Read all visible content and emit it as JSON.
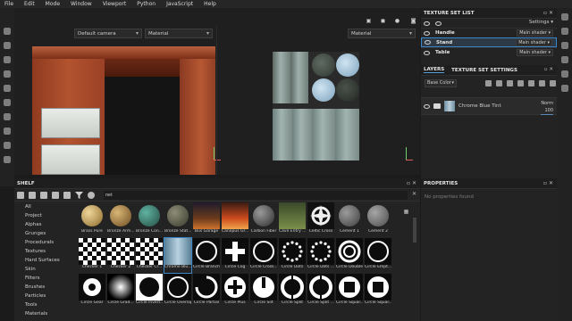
{
  "menu": [
    "File",
    "Edit",
    "Mode",
    "Window",
    "Viewport",
    "Python",
    "JavaScript",
    "Help"
  ],
  "viewport": {
    "camera_dropdown": "Default camera",
    "material_dropdown_left": "Material",
    "material_dropdown_right": "Material",
    "toolbar_icons": [
      "mode-icon",
      "cube-icon",
      "sphere-icon",
      "camera-icon"
    ]
  },
  "texture_set_list": {
    "title": "TEXTURE SET LIST",
    "settings_label": "Settings",
    "rows": [
      {
        "name": "Handle",
        "shader": "Main shader"
      },
      {
        "name": "Stand",
        "shader": "Main shader"
      },
      {
        "name": "Table",
        "shader": "Main shader"
      }
    ]
  },
  "layers": {
    "tab_layers": "LAYERS",
    "tab_settings": "TEXTURE SET SETTINGS",
    "channel": "Base Color",
    "layer": {
      "name": "Chrome Blue Tint",
      "blend": "Norm",
      "opacity": "100"
    }
  },
  "properties": {
    "title": "PROPERTIES",
    "empty": "No properties found"
  },
  "shelf": {
    "title": "SHELF",
    "search_value": "net",
    "categories": [
      "All",
      "Project",
      "Alphas",
      "Grunges",
      "Procedurals",
      "Textures",
      "Hard Surfaces",
      "Skin",
      "Filters",
      "Brushes",
      "Particles",
      "Tools",
      "Materials"
    ],
    "items_row1": [
      "Brass Pure",
      "Bronze Arm...",
      "Bronze Con...",
      "Bronze Stat...",
      "Bus Garage",
      "Canopus Gr...",
      "Carbon Fiber",
      "Cave Entry ...",
      "Celtic Cross",
      "Cement 1",
      "Cement 2"
    ],
    "items_row2": [
      "Checker 1",
      "Checker 2",
      "Checker Cr...",
      "Chrome Blu...",
      "Circle Branch",
      "Circle Cog",
      "Circle Cross...",
      "Circle Dots",
      "Circle Dots ...",
      "Circle Double",
      "Circle Empt..."
    ],
    "items_row3": [
      "Circle Gear",
      "Circle Grad...",
      "Circle Invert...",
      "Circle Overlap",
      "Circle Partial",
      "Circle Plus",
      "Circle Slit",
      "Circle Split",
      "Circle Split ...",
      "Circle Squar...",
      "Circle Squar..."
    ]
  },
  "colors": {
    "accent": "#3b86c6",
    "panel": "#232323",
    "background": "#1b1b1b"
  }
}
